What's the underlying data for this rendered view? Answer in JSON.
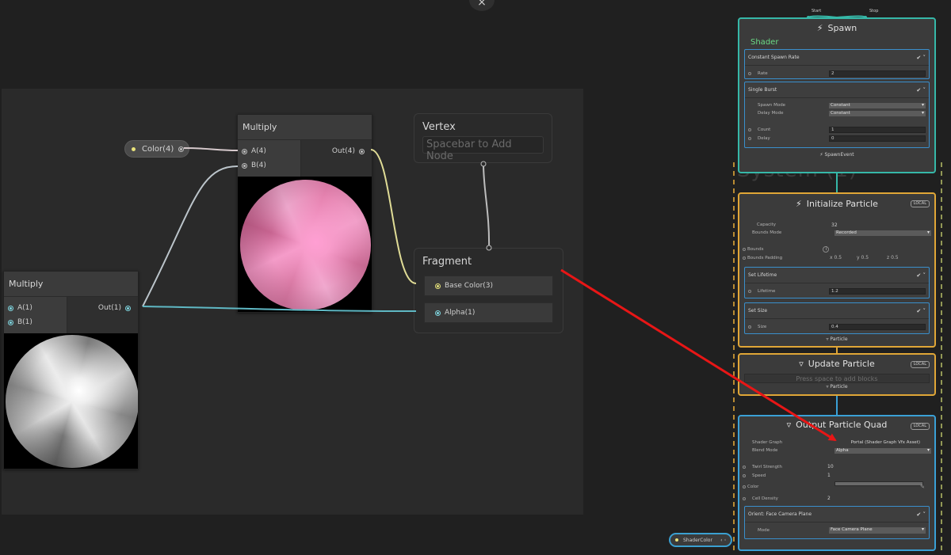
{
  "app": {
    "close_icon": "×"
  },
  "shader_graph": {
    "property_pill": {
      "label": "Color(4)"
    },
    "multiply_top": {
      "title": "Multiply",
      "in_a": "A(4)",
      "in_b": "B(4)",
      "out": "Out(4)"
    },
    "multiply_left": {
      "title": "Multiply",
      "in_a": "A(1)",
      "in_b": "B(1)",
      "out": "Out(1)"
    },
    "vertex": {
      "title": "Vertex",
      "placeholder": "Spacebar to Add Node"
    },
    "fragment": {
      "title": "Fragment",
      "blocks": [
        "Base Color(3)",
        "Alpha(1)"
      ]
    }
  },
  "vfx": {
    "flow_start": "Start",
    "flow_stop": "Stop",
    "system_label": "System (1)",
    "spawn": {
      "title": "Spawn",
      "shader_label": "Shader",
      "footer": "SpawnEvent",
      "blocks": [
        {
          "title": "Constant Spawn Rate",
          "rows": [
            {
              "label": "Rate",
              "value": "2"
            }
          ]
        },
        {
          "title": "Single Burst",
          "dropdowns": [
            {
              "label": "Spawn Mode",
              "value": "Constant"
            },
            {
              "label": "Delay Mode",
              "value": "Constant"
            }
          ],
          "rows": [
            {
              "label": "Count",
              "value": "1"
            },
            {
              "label": "Delay",
              "value": "0"
            }
          ]
        }
      ]
    },
    "init": {
      "title": "Initialize Particle",
      "badge": "LOCAL",
      "capacity_label": "Capacity",
      "capacity_value": "32",
      "bounds_mode_label": "Bounds Mode",
      "bounds_mode_value": "Recorded",
      "bounds_label": "Bounds",
      "bounds_padding_label": "Bounds Padding",
      "bounds_padding": {
        "x": "0.5",
        "y": "0.5",
        "z": "0.5"
      },
      "axis_x": "x",
      "axis_y": "y",
      "axis_z": "z",
      "set_lifetime": {
        "title": "Set Lifetime",
        "label": "Lifetime",
        "value": "1.2"
      },
      "set_size": {
        "title": "Set Size",
        "label": "Size",
        "value": "0.4"
      },
      "footer": "Particle"
    },
    "update": {
      "title": "Update Particle",
      "badge": "LOCAL",
      "placeholder": "Press space to add blocks",
      "footer": "Particle"
    },
    "output": {
      "title": "Output Particle Quad",
      "badge": "LOCAL",
      "shader_graph_label": "Shader Graph",
      "shader_graph_value": "Portal (Shader Graph Vfx Asset)",
      "blend_mode_label": "Blend Mode",
      "blend_mode_value": "Alpha",
      "twirl_label": "Twirl Strength",
      "twirl_value": "10",
      "speed_label": "Speed",
      "speed_value": "1",
      "color_label": "Color",
      "cell_density_label": "Cell Density",
      "cell_density_value": "2",
      "orient": {
        "title": "Orient: Face Camera Plane",
        "mode_label": "Mode",
        "mode_value": "Face Camera Plane"
      }
    },
    "shader_color_pill": "ShaderColor"
  },
  "colors": {
    "annotation_arrow": "#e81616",
    "spawn_border": "#36b8a8",
    "init_border": "#e0a637",
    "output_border": "#3aa0d6",
    "shader_label": "#6bdc86"
  }
}
